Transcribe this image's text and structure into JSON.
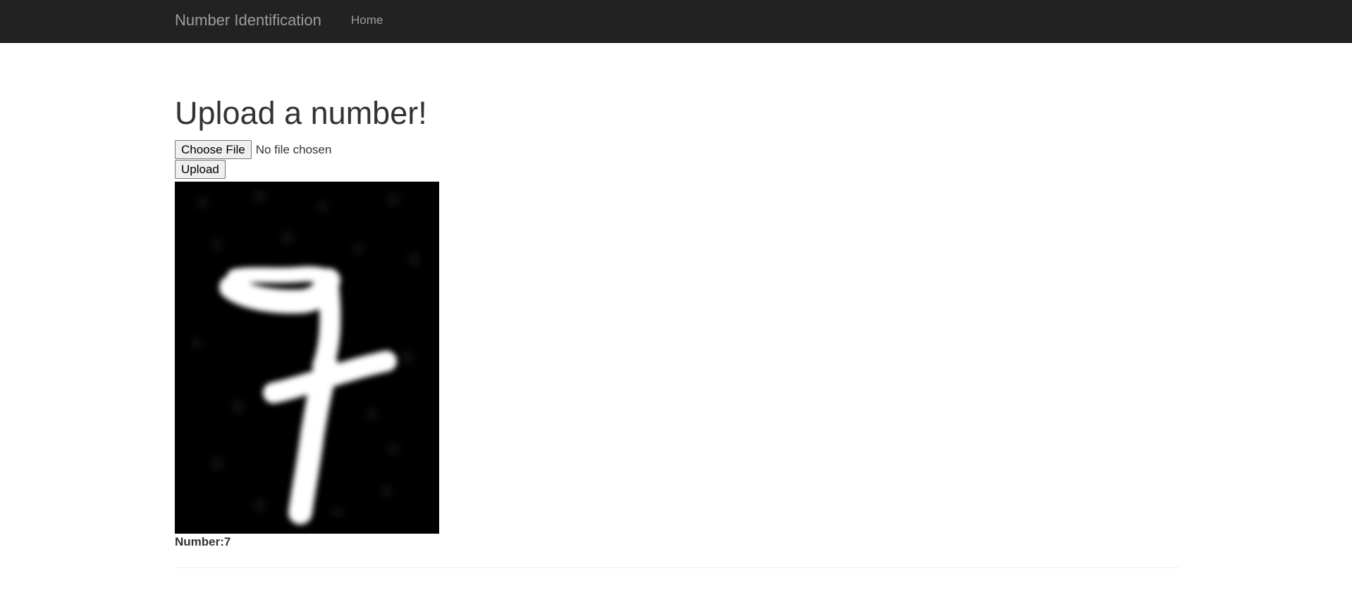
{
  "navbar": {
    "brand": "Number Identification",
    "links": [
      "Home"
    ]
  },
  "main": {
    "title": "Upload a number!",
    "file_input": {
      "button_label": "Choose File",
      "status": "No file chosen"
    },
    "upload_button": "Upload",
    "image_content": "handwritten digit 7, white on black",
    "result": {
      "label": "Number:",
      "value": "7"
    }
  },
  "colors": {
    "navbar_bg": "#222222",
    "navbar_text": "#9d9d9d",
    "body_text": "#333333",
    "image_bg": "#000000",
    "digit_stroke": "#ffffff"
  }
}
